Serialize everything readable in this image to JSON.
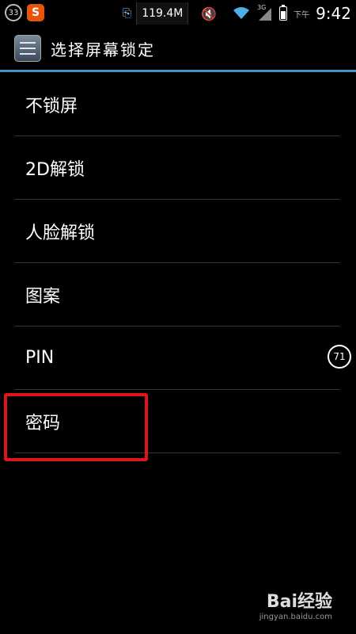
{
  "status_bar": {
    "notification_count": "33",
    "sogou_label": "S",
    "memory": "119.4M",
    "ampm": "下午",
    "time": "9:42",
    "net_label": "3G",
    "battery_level": 0.75
  },
  "action_bar": {
    "title": "选择屏幕锁定"
  },
  "lock_options": [
    {
      "label": "不锁屏"
    },
    {
      "label": "2D解锁"
    },
    {
      "label": "人脸解锁"
    },
    {
      "label": "图案"
    },
    {
      "label": "PIN"
    },
    {
      "label": "密码"
    }
  ],
  "side_badge": "71",
  "watermark": {
    "brand": "Bai经验",
    "url": "jingyan.baidu.com"
  },
  "colors": {
    "accent": "#3f95c4",
    "highlight": "#e0151b"
  }
}
